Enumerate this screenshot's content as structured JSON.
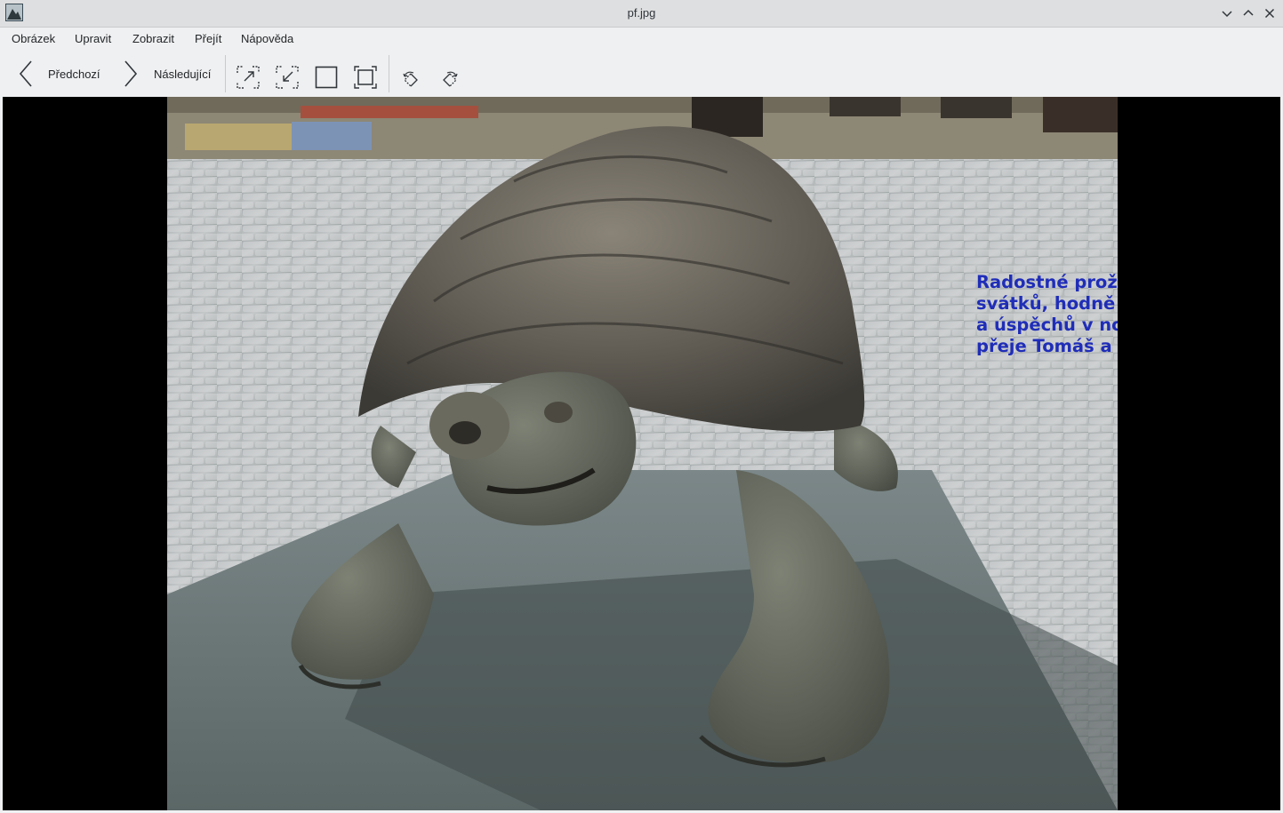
{
  "window": {
    "title": "pf.jpg",
    "icon": "image-viewer-app-icon"
  },
  "menu": {
    "items": [
      {
        "label": "Obrázek"
      },
      {
        "label": "Upravit"
      },
      {
        "label": "Zobrazit"
      },
      {
        "label": "Přejít"
      },
      {
        "label": "Nápověda"
      }
    ]
  },
  "toolbar": {
    "previous_label": "Předchozí",
    "next_label": "Následující",
    "icons": [
      "zoom-in-icon",
      "zoom-out-icon",
      "actual-size-icon",
      "zoom-to-fit-icon",
      "rotate-left-icon",
      "rotate-right-icon"
    ]
  },
  "image": {
    "caption_lines": [
      "Radostné prožití vánočních",
      "svátků, hodně zdraví, štěstí",
      "a úspěchů v novém roce",
      "přeje Tomáš a mama."
    ],
    "caption_color": "#1f2db8"
  },
  "colors": {
    "background": "#eff0f1",
    "viewer_background": "#000000"
  }
}
